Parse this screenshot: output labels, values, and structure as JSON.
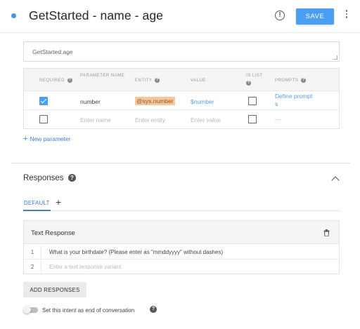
{
  "header": {
    "title": "GetStarted - name - age",
    "save_label": "SAVE"
  },
  "action": {
    "value": "GetStarted.age"
  },
  "parameters": {
    "columns": {
      "required": "REQUIRED",
      "name": "PARAMETER NAME",
      "entity": "ENTITY",
      "value": "VALUE",
      "is_list": "IS LIST",
      "prompts": "PROMPTS"
    },
    "rows": [
      {
        "required": true,
        "name": "number",
        "entity": "@sys.number",
        "value": "$number",
        "is_list": false,
        "prompts_line1": "Define prompt",
        "prompts_line2": "s"
      }
    ],
    "empty_row": {
      "name_placeholder": "Enter name",
      "entity_placeholder": "Enter entity",
      "value_placeholder": "Enter value",
      "prompts": "—"
    },
    "new_parameter_label": "New parameter"
  },
  "responses": {
    "title": "Responses",
    "tabs": [
      {
        "label": "DEFAULT",
        "active": true
      }
    ],
    "add_tab_label": "+",
    "text_response": {
      "title": "Text Response",
      "lines": [
        {
          "num": "1",
          "text": "What is your birthdate? (Please enter as \"mmddyyyy\" without dashes)"
        },
        {
          "num": "2",
          "placeholder": "Enter a text response variant"
        }
      ]
    },
    "add_responses_label": "ADD RESPONSES"
  },
  "end_conversation": {
    "label": "Set this intent as end of conversation",
    "enabled": false
  },
  "colors": {
    "accent": "#4a9ff5",
    "link": "#3f7fd1",
    "entity_highlight": "#f6c79f"
  }
}
